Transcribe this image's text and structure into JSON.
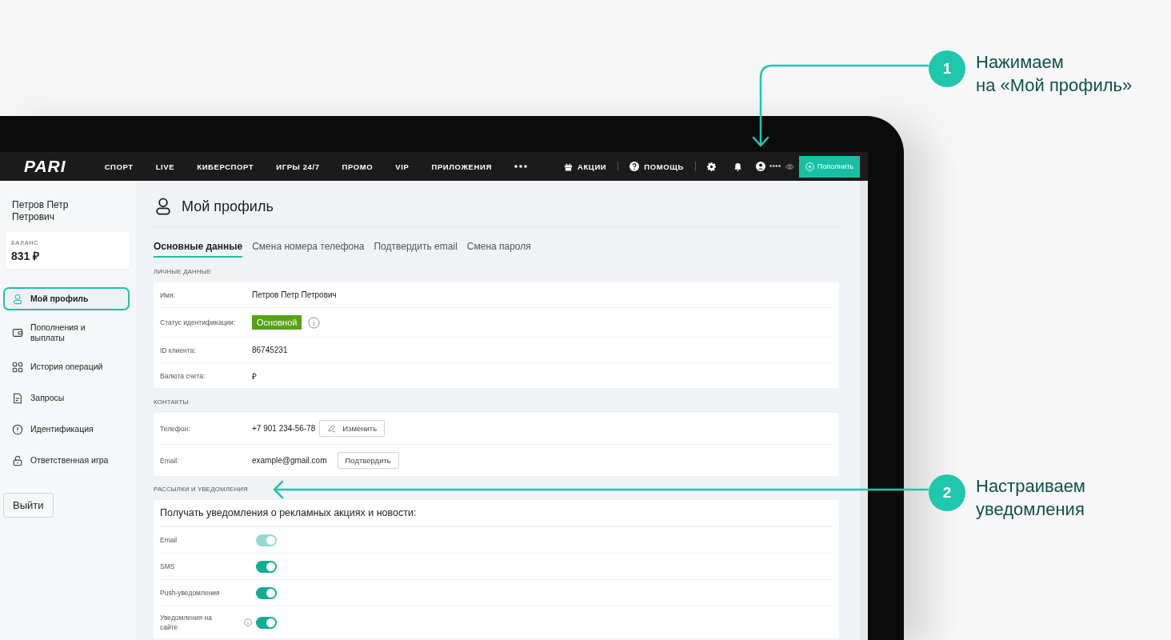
{
  "callouts": [
    {
      "number": "1",
      "lines": [
        "Нажимаем",
        "на «Мой профиль»"
      ]
    },
    {
      "number": "2",
      "lines": [
        "Настраиваем",
        "уведомления"
      ]
    }
  ],
  "navbar": {
    "logo": "PARI",
    "links": [
      "СПОРТ",
      "LIVE",
      "КИБЕРСПОРТ",
      "ИГРЫ 24/7",
      "ПРОМО",
      "VIP",
      "ПРИЛОЖЕНИЯ"
    ],
    "promo": "АКЦИИ",
    "help": "ПОМОЩЬ",
    "account": "****",
    "deposit": "Пополнить"
  },
  "sidebar": {
    "user_name": "Петров Петр Петрович",
    "balance_label": "БАЛАНС",
    "balance": "831 ₽",
    "items": [
      {
        "label": "Мой профиль",
        "selected": true
      },
      {
        "label": "Пополнения и выплаты",
        "selected": false
      },
      {
        "label": "История операций",
        "selected": false
      },
      {
        "label": "Запросы",
        "selected": false
      },
      {
        "label": "Идентификация",
        "selected": false
      },
      {
        "label": "Ответственная игра",
        "selected": false
      }
    ],
    "logout": "Выйти"
  },
  "page": {
    "title": "Мой профиль",
    "tabs": [
      {
        "label": "Основные данные",
        "selected": true
      },
      {
        "label": "Смена номера телефона",
        "selected": false
      },
      {
        "label": "Подтвердить email",
        "selected": false
      },
      {
        "label": "Смена пароля",
        "selected": false
      }
    ],
    "sections": [
      {
        "title": "ЛИЧНЫЕ ДАННЫЕ",
        "rows": [
          {
            "kind": "text",
            "label": "Имя:",
            "value": "Петров Петр Петрович"
          },
          {
            "kind": "badge",
            "label": "Статус идентификации:",
            "value": "Основной"
          },
          {
            "kind": "text",
            "label": "ID клиента:",
            "value": "86745231"
          },
          {
            "kind": "text",
            "label": "Валюта счета:",
            "value": "₽"
          }
        ]
      },
      {
        "title": "КОНТАКТЫ",
        "rows": [
          {
            "kind": "edit",
            "label": "Телефон:",
            "value": "+7 901 234-56-78",
            "action": "Изменить"
          },
          {
            "kind": "confirm",
            "label": "Email:",
            "value": "example@gmail.com",
            "action": "Подтвердить"
          }
        ]
      }
    ],
    "notifications": {
      "title": "РАССЫЛКИ И УВЕДОМЛЕНИЯ",
      "heading": "Получать уведомления о рекламных акциях и новости:",
      "toggles": [
        {
          "label": "Email",
          "on": true,
          "disabled": true,
          "info": false
        },
        {
          "label": "SMS",
          "on": true,
          "disabled": false,
          "info": false
        },
        {
          "label": "Push-уведомления",
          "on": true,
          "disabled": false,
          "info": false
        },
        {
          "label": "Уведомления на сайте",
          "on": true,
          "disabled": false,
          "info": true
        }
      ]
    }
  }
}
